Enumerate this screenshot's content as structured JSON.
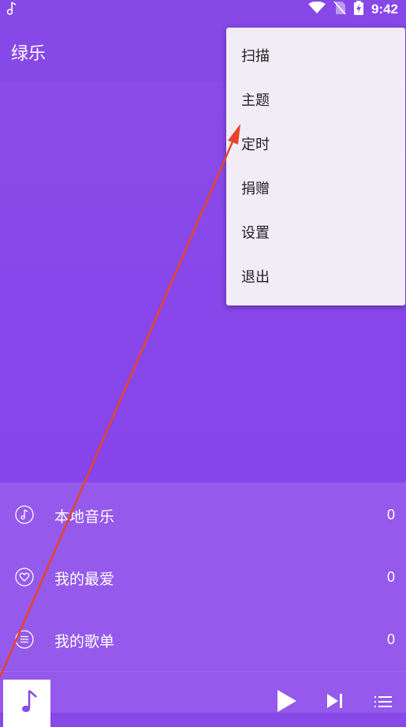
{
  "status_bar": {
    "time": "9:42",
    "icons": [
      "music-note-icon",
      "wifi-icon",
      "no-sim-icon",
      "battery-charging-icon"
    ]
  },
  "app": {
    "title": "绿乐"
  },
  "menu": {
    "items": [
      {
        "label": "扫描"
      },
      {
        "label": "主题"
      },
      {
        "label": "定时"
      },
      {
        "label": "捐赠"
      },
      {
        "label": "设置"
      },
      {
        "label": "退出"
      }
    ]
  },
  "list": {
    "items": [
      {
        "label": "本地音乐",
        "count": "0",
        "icon": "music-disc-icon"
      },
      {
        "label": "我的最爱",
        "count": "0",
        "icon": "heart-icon"
      },
      {
        "label": "我的歌单",
        "count": "0",
        "icon": "playlist-icon"
      }
    ]
  },
  "player": {
    "icons": [
      "album-art-icon",
      "play-icon",
      "skip-next-icon",
      "queue-icon"
    ]
  },
  "colors": {
    "primary": "#8748e8",
    "list_bg": "#9559ec",
    "menu_bg": "#f1ecf6",
    "annotation_arrow": "#e8432b"
  }
}
